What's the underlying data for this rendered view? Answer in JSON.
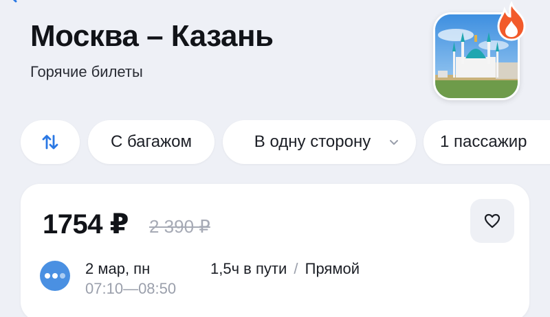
{
  "route": {
    "title": "Москва – Казань",
    "subtitle": "Горячие билеты"
  },
  "icons": {
    "back": "chevron-left-icon",
    "hot": "flame-icon",
    "swap": "swap-vertical-icon",
    "dropdown": "chevron-down-icon",
    "favorite": "heart-icon"
  },
  "filters": {
    "baggage": "С багажом",
    "direction": "В одну сторону",
    "passengers": "1 пассажир"
  },
  "ticket": {
    "price": "1754 ₽",
    "old_price": "2 390 ₽",
    "date": "2 мар, пн",
    "time_depart": "07:10",
    "time_dash": "—",
    "time_arrive": "08:50",
    "duration": "1,5ч в пути",
    "separator": "/",
    "stops": "Прямой"
  },
  "colors": {
    "background": "#eef0f6",
    "accent": "#4a90e2",
    "hot": "#f25a2a",
    "muted": "#9a9fab"
  }
}
